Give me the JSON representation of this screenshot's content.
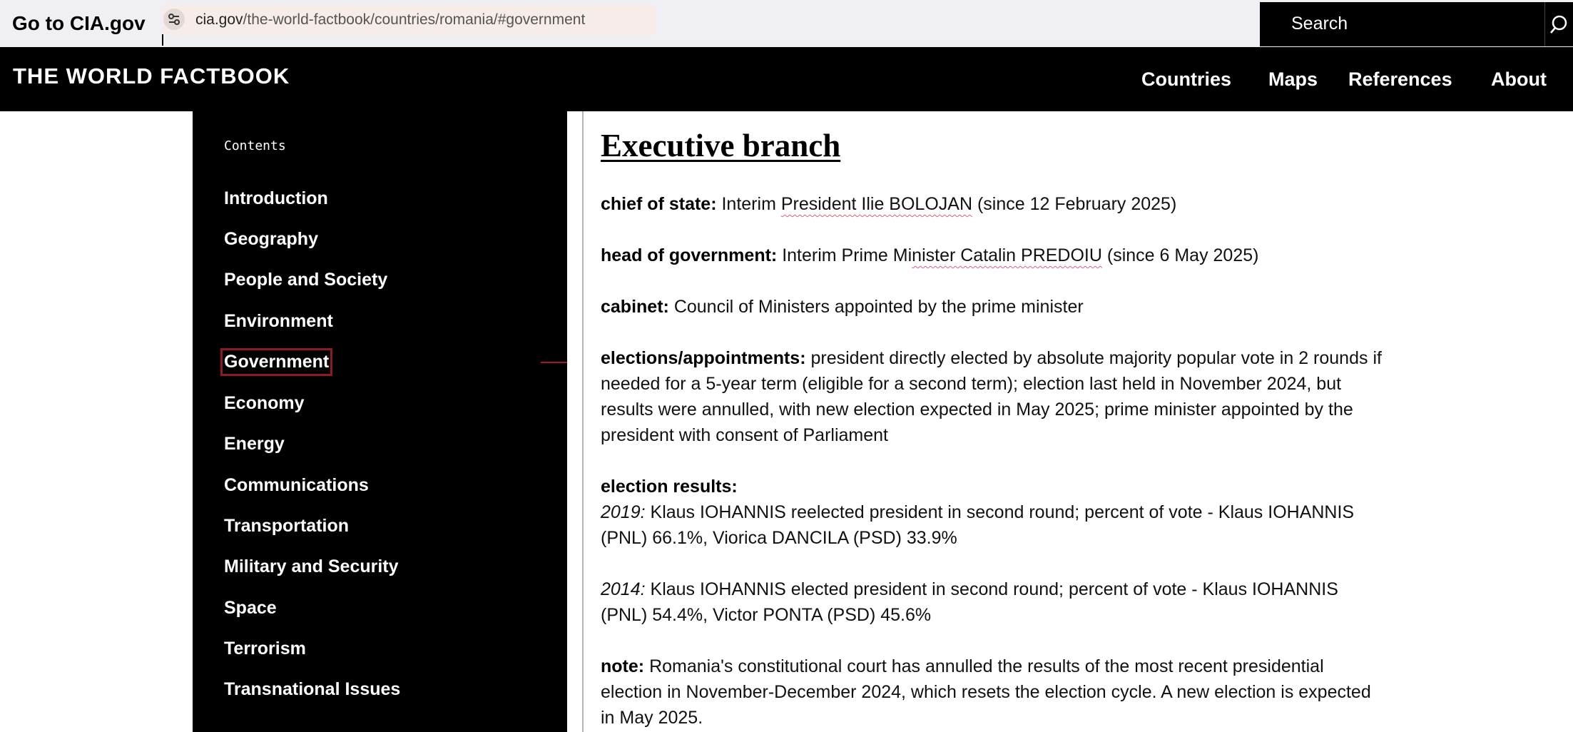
{
  "browser": {
    "go_to_label": "Go to CIA.gov",
    "url_host": "cia.gov",
    "url_path": "/the-world-factbook/countries/romania/#government",
    "search_placeholder": "Search"
  },
  "site": {
    "logo": "THE WORLD FACTBOOK",
    "nav": [
      "Countries",
      "Maps",
      "References",
      "About"
    ]
  },
  "sidebar": {
    "contents_label": "Contents",
    "active_item": "Government",
    "items": [
      "Introduction",
      "Geography",
      "People and Society",
      "Environment",
      "Government",
      "Economy",
      "Energy",
      "Communications",
      "Transportation",
      "Military and Security",
      "Space",
      "Terrorism",
      "Transnational Issues"
    ]
  },
  "main": {
    "heading": "Executive branch",
    "chief_of_state": {
      "label": "chief of state:",
      "pre": "Interim",
      "name": "President Ilie BOLOJAN",
      "post": "(since 12 February 2025)"
    },
    "head_of_government": {
      "label": "head of government:",
      "pre": "Interim Prime Mi",
      "name": "nister Catalin PREDOIU",
      "post": "(since 6 May 2025)"
    },
    "cabinet": {
      "label": "cabinet:",
      "text": "Council of Ministers appointed by the prime minister"
    },
    "elections": {
      "label": "elections/appointments:",
      "text": "president directly elected by absolute majority popular vote in 2 rounds if needed for a 5-year term (eligible for a second term); election last held in November 2024, but results were annulled, with new election expected in May 2025; prime minister appointed by the president with consent of Parliament"
    },
    "results": {
      "label": "election results:",
      "entries": [
        {
          "year": "2019:",
          "text": "Klaus IOHANNIS reelected president in second round; percent of vote - Klaus IOHANNIS (PNL) 66.1%, Viorica DANCILA (PSD) 33.9%"
        },
        {
          "year": "2014:",
          "text": "Klaus IOHANNIS elected president in second round; percent of vote - Klaus IOHANNIS (PNL) 54.4%, Victor PONTA (PSD) 45.6%"
        }
      ]
    },
    "note": {
      "label": "note:",
      "text": "Romania's constitutional court has annulled the results of the most recent presidential election in November-December 2024, which resets the election cycle. A new election is expected in May 2025."
    }
  }
}
